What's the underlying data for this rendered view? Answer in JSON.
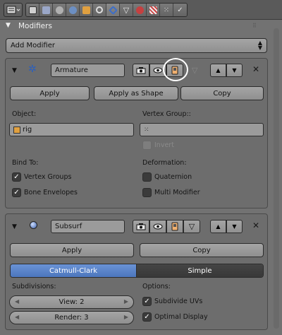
{
  "header": {
    "tabs": [
      {
        "icon": "render-icon"
      },
      {
        "icon": "render-layers-icon"
      },
      {
        "icon": "scene-icon"
      },
      {
        "icon": "world-icon"
      },
      {
        "icon": "object-icon"
      },
      {
        "icon": "constraints-icon"
      },
      {
        "icon": "modifiers-icon",
        "active": true
      },
      {
        "icon": "data-icon"
      },
      {
        "icon": "material-icon"
      },
      {
        "icon": "texture-icon"
      },
      {
        "icon": "particles-icon"
      },
      {
        "icon": "physics-icon"
      }
    ]
  },
  "section": {
    "title": "Modifiers",
    "add_modifier": "Add Modifier"
  },
  "armature": {
    "name": "Armature",
    "apply": "Apply",
    "apply_as_shape": "Apply as Shape",
    "copy": "Copy",
    "object_label": "Object:",
    "object_value": "rig",
    "vertex_group_label": "Vertex Group::",
    "vertex_group_value": "",
    "invert_label": "Invert",
    "bind_to_label": "Bind To:",
    "vertex_groups": "Vertex Groups",
    "bone_envelopes": "Bone Envelopes",
    "deformation_label": "Deformation:",
    "quaternion": "Quaternion",
    "multi_modifier": "Multi Modifier",
    "vertex_groups_checked": true,
    "bone_envelopes_checked": true,
    "invert_checked": false,
    "quaternion_checked": false,
    "multi_modifier_checked": false
  },
  "subsurf": {
    "name": "Subsurf",
    "apply": "Apply",
    "copy": "Copy",
    "mode_catmull": "Catmull-Clark",
    "mode_simple": "Simple",
    "subdivisions_label": "Subdivisions:",
    "view": "View: 2",
    "render": "Render: 3",
    "options_label": "Options:",
    "subdivide_uvs": "Subdivide UVs",
    "optimal_display": "Optimal Display",
    "subdivide_uvs_checked": true,
    "optimal_display_checked": true
  },
  "colors": {
    "accent": "#5680c2",
    "panel": "#6d6d6d",
    "background": "#727272"
  }
}
